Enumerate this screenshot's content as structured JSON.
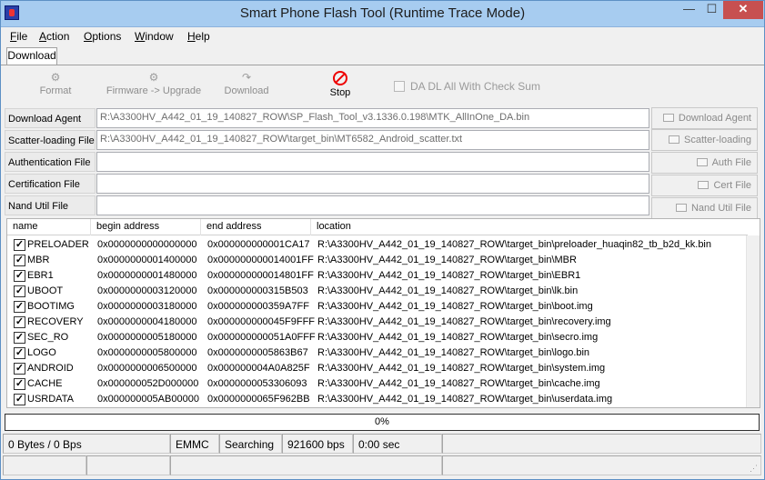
{
  "window": {
    "title": "Smart Phone Flash Tool (Runtime Trace Mode)",
    "minimize": "—",
    "maximize": "☐",
    "close": "✕"
  },
  "menu": [
    "File",
    "Action",
    "Options",
    "Window",
    "Help"
  ],
  "tab": {
    "label": "Download"
  },
  "toolbar": {
    "format": {
      "label": "Format",
      "icon": "format-icon"
    },
    "firmware_upgrade": {
      "label": "Firmware -> Upgrade",
      "icon": "firmware-upgrade-icon"
    },
    "download": {
      "label": "Download",
      "icon": "download-icon"
    },
    "stop": {
      "label": "Stop",
      "icon": "stop-icon"
    },
    "da_checksum": {
      "label": "DA DL All With Check Sum",
      "checked": false
    }
  },
  "files": {
    "download_agent": {
      "label": "Download Agent",
      "value": "R:\\A3300HV_A442_01_19_140827_ROW\\SP_Flash_Tool_v3.1336.0.198\\MTK_AllInOne_DA.bin",
      "button": "Download Agent"
    },
    "scatter": {
      "label": "Scatter-loading File",
      "value": "R:\\A3300HV_A442_01_19_140827_ROW\\target_bin\\MT6582_Android_scatter.txt",
      "button": "Scatter-loading"
    },
    "authentication": {
      "label": "Authentication File",
      "value": "",
      "button": "Auth File"
    },
    "certification": {
      "label": "Certification File",
      "value": "",
      "button": "Cert File"
    },
    "nand_util": {
      "label": "Nand Util File",
      "value": "",
      "button": "Nand Util File"
    }
  },
  "table": {
    "columns": [
      "name",
      "begin address",
      "end address",
      "location"
    ],
    "rows": [
      {
        "checked": true,
        "name": "PRELOADER",
        "begin": "0x0000000000000000",
        "end": "0x000000000001CA17",
        "location": "R:\\A3300HV_A442_01_19_140827_ROW\\target_bin\\preloader_huaqin82_tb_b2d_kk.bin"
      },
      {
        "checked": true,
        "name": "MBR",
        "begin": "0x0000000001400000",
        "end": "0x000000000014001FF",
        "location": "R:\\A3300HV_A442_01_19_140827_ROW\\target_bin\\MBR"
      },
      {
        "checked": true,
        "name": "EBR1",
        "begin": "0x0000000001480000",
        "end": "0x000000000014801FF",
        "location": "R:\\A3300HV_A442_01_19_140827_ROW\\target_bin\\EBR1"
      },
      {
        "checked": true,
        "name": "UBOOT",
        "begin": "0x0000000003120000",
        "end": "0x000000000315B503",
        "location": "R:\\A3300HV_A442_01_19_140827_ROW\\target_bin\\lk.bin"
      },
      {
        "checked": true,
        "name": "BOOTIMG",
        "begin": "0x0000000003180000",
        "end": "0x000000000359A7FF",
        "location": "R:\\A3300HV_A442_01_19_140827_ROW\\target_bin\\boot.img"
      },
      {
        "checked": true,
        "name": "RECOVERY",
        "begin": "0x0000000004180000",
        "end": "0x000000000045F9FFF",
        "location": "R:\\A3300HV_A442_01_19_140827_ROW\\target_bin\\recovery.img"
      },
      {
        "checked": true,
        "name": "SEC_RO",
        "begin": "0x0000000005180000",
        "end": "0x000000000051A0FFF",
        "location": "R:\\A3300HV_A442_01_19_140827_ROW\\target_bin\\secro.img"
      },
      {
        "checked": true,
        "name": "LOGO",
        "begin": "0x0000000005800000",
        "end": "0x0000000005863B67",
        "location": "R:\\A3300HV_A442_01_19_140827_ROW\\target_bin\\logo.bin"
      },
      {
        "checked": true,
        "name": "ANDROID",
        "begin": "0x0000000006500000",
        "end": "0x000000004A0A825F",
        "location": "R:\\A3300HV_A442_01_19_140827_ROW\\target_bin\\system.img"
      },
      {
        "checked": true,
        "name": "CACHE",
        "begin": "0x000000052D000000",
        "end": "0x0000000053306093",
        "location": "R:\\A3300HV_A442_01_19_140827_ROW\\target_bin\\cache.img"
      },
      {
        "checked": true,
        "name": "USRDATA",
        "begin": "0x000000005AB00000",
        "end": "0x0000000065F962BB",
        "location": "R:\\A3300HV_A442_01_19_140827_ROW\\target_bin\\userdata.img"
      }
    ]
  },
  "progress": {
    "text": "0%",
    "value": 0
  },
  "status": {
    "transfer": "0 Bytes / 0 Bps",
    "storage": "EMMC",
    "state": "Searching",
    "baud": "921600 bps",
    "time": "0:00 sec"
  },
  "colors": {
    "title_bar": "#a7ccf0",
    "close_button": "#c75050",
    "stop_icon": "#e00000"
  }
}
